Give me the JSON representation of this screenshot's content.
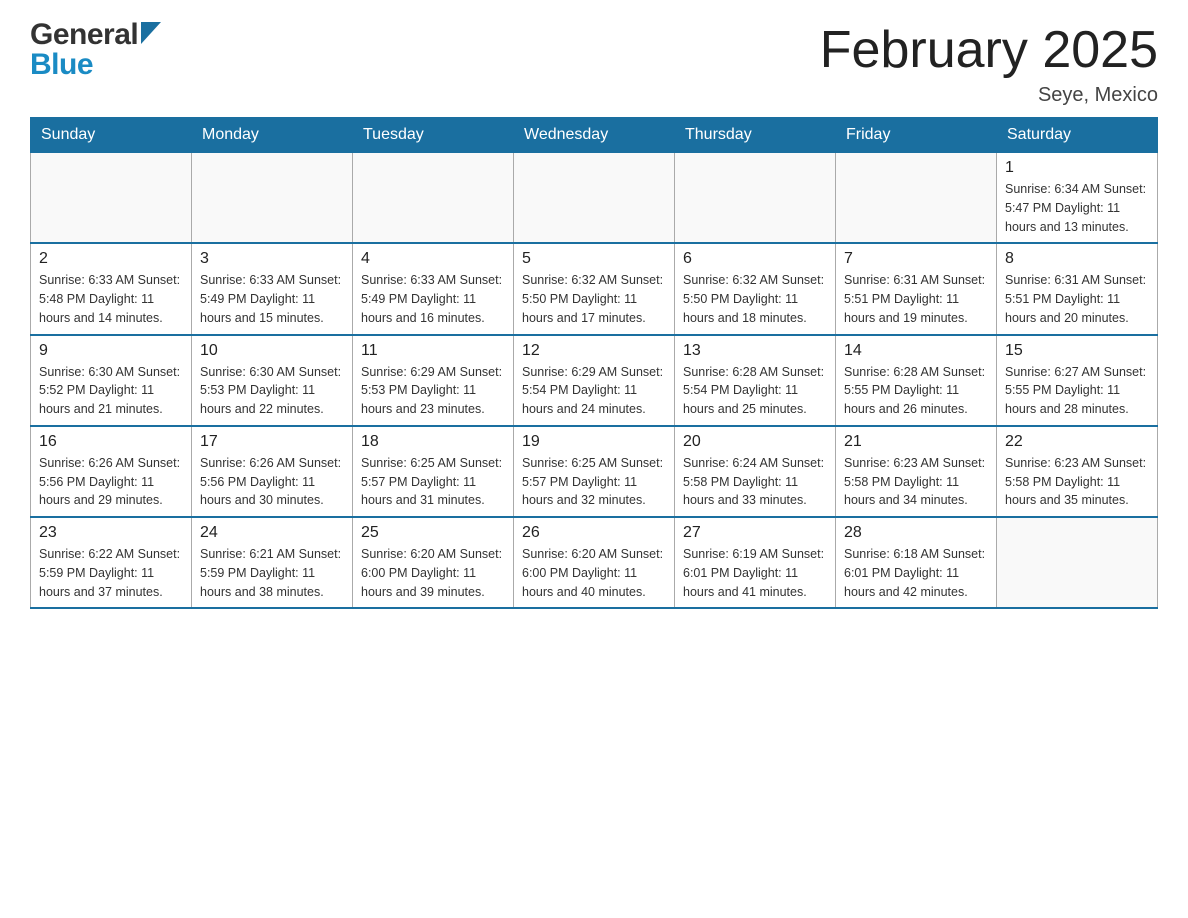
{
  "header": {
    "month_title": "February 2025",
    "location": "Seye, Mexico",
    "logo_general": "General",
    "logo_blue": "Blue"
  },
  "days_of_week": [
    "Sunday",
    "Monday",
    "Tuesday",
    "Wednesday",
    "Thursday",
    "Friday",
    "Saturday"
  ],
  "weeks": [
    {
      "days": [
        {
          "number": "",
          "info": ""
        },
        {
          "number": "",
          "info": ""
        },
        {
          "number": "",
          "info": ""
        },
        {
          "number": "",
          "info": ""
        },
        {
          "number": "",
          "info": ""
        },
        {
          "number": "",
          "info": ""
        },
        {
          "number": "1",
          "info": "Sunrise: 6:34 AM\nSunset: 5:47 PM\nDaylight: 11 hours\nand 13 minutes."
        }
      ]
    },
    {
      "days": [
        {
          "number": "2",
          "info": "Sunrise: 6:33 AM\nSunset: 5:48 PM\nDaylight: 11 hours\nand 14 minutes."
        },
        {
          "number": "3",
          "info": "Sunrise: 6:33 AM\nSunset: 5:49 PM\nDaylight: 11 hours\nand 15 minutes."
        },
        {
          "number": "4",
          "info": "Sunrise: 6:33 AM\nSunset: 5:49 PM\nDaylight: 11 hours\nand 16 minutes."
        },
        {
          "number": "5",
          "info": "Sunrise: 6:32 AM\nSunset: 5:50 PM\nDaylight: 11 hours\nand 17 minutes."
        },
        {
          "number": "6",
          "info": "Sunrise: 6:32 AM\nSunset: 5:50 PM\nDaylight: 11 hours\nand 18 minutes."
        },
        {
          "number": "7",
          "info": "Sunrise: 6:31 AM\nSunset: 5:51 PM\nDaylight: 11 hours\nand 19 minutes."
        },
        {
          "number": "8",
          "info": "Sunrise: 6:31 AM\nSunset: 5:51 PM\nDaylight: 11 hours\nand 20 minutes."
        }
      ]
    },
    {
      "days": [
        {
          "number": "9",
          "info": "Sunrise: 6:30 AM\nSunset: 5:52 PM\nDaylight: 11 hours\nand 21 minutes."
        },
        {
          "number": "10",
          "info": "Sunrise: 6:30 AM\nSunset: 5:53 PM\nDaylight: 11 hours\nand 22 minutes."
        },
        {
          "number": "11",
          "info": "Sunrise: 6:29 AM\nSunset: 5:53 PM\nDaylight: 11 hours\nand 23 minutes."
        },
        {
          "number": "12",
          "info": "Sunrise: 6:29 AM\nSunset: 5:54 PM\nDaylight: 11 hours\nand 24 minutes."
        },
        {
          "number": "13",
          "info": "Sunrise: 6:28 AM\nSunset: 5:54 PM\nDaylight: 11 hours\nand 25 minutes."
        },
        {
          "number": "14",
          "info": "Sunrise: 6:28 AM\nSunset: 5:55 PM\nDaylight: 11 hours\nand 26 minutes."
        },
        {
          "number": "15",
          "info": "Sunrise: 6:27 AM\nSunset: 5:55 PM\nDaylight: 11 hours\nand 28 minutes."
        }
      ]
    },
    {
      "days": [
        {
          "number": "16",
          "info": "Sunrise: 6:26 AM\nSunset: 5:56 PM\nDaylight: 11 hours\nand 29 minutes."
        },
        {
          "number": "17",
          "info": "Sunrise: 6:26 AM\nSunset: 5:56 PM\nDaylight: 11 hours\nand 30 minutes."
        },
        {
          "number": "18",
          "info": "Sunrise: 6:25 AM\nSunset: 5:57 PM\nDaylight: 11 hours\nand 31 minutes."
        },
        {
          "number": "19",
          "info": "Sunrise: 6:25 AM\nSunset: 5:57 PM\nDaylight: 11 hours\nand 32 minutes."
        },
        {
          "number": "20",
          "info": "Sunrise: 6:24 AM\nSunset: 5:58 PM\nDaylight: 11 hours\nand 33 minutes."
        },
        {
          "number": "21",
          "info": "Sunrise: 6:23 AM\nSunset: 5:58 PM\nDaylight: 11 hours\nand 34 minutes."
        },
        {
          "number": "22",
          "info": "Sunrise: 6:23 AM\nSunset: 5:58 PM\nDaylight: 11 hours\nand 35 minutes."
        }
      ]
    },
    {
      "days": [
        {
          "number": "23",
          "info": "Sunrise: 6:22 AM\nSunset: 5:59 PM\nDaylight: 11 hours\nand 37 minutes."
        },
        {
          "number": "24",
          "info": "Sunrise: 6:21 AM\nSunset: 5:59 PM\nDaylight: 11 hours\nand 38 minutes."
        },
        {
          "number": "25",
          "info": "Sunrise: 6:20 AM\nSunset: 6:00 PM\nDaylight: 11 hours\nand 39 minutes."
        },
        {
          "number": "26",
          "info": "Sunrise: 6:20 AM\nSunset: 6:00 PM\nDaylight: 11 hours\nand 40 minutes."
        },
        {
          "number": "27",
          "info": "Sunrise: 6:19 AM\nSunset: 6:01 PM\nDaylight: 11 hours\nand 41 minutes."
        },
        {
          "number": "28",
          "info": "Sunrise: 6:18 AM\nSunset: 6:01 PM\nDaylight: 11 hours\nand 42 minutes."
        },
        {
          "number": "",
          "info": ""
        }
      ]
    }
  ]
}
